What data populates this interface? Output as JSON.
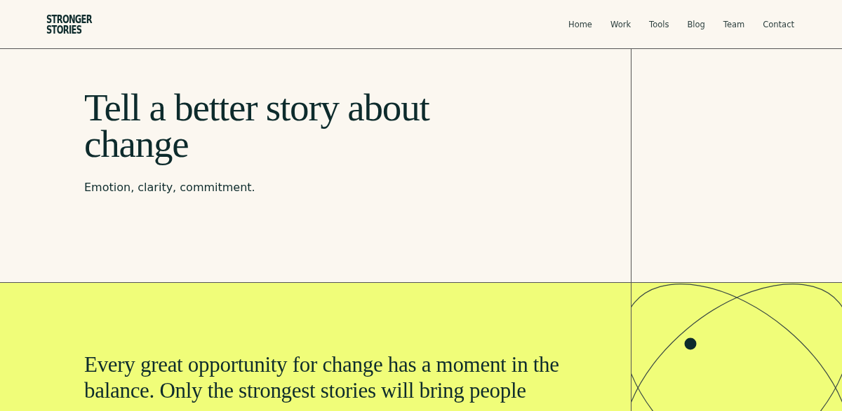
{
  "header": {
    "logo": [
      "STRONGER",
      "STORIES"
    ],
    "nav": [
      {
        "label": "Home"
      },
      {
        "label": "Work"
      },
      {
        "label": "Tools"
      },
      {
        "label": "Blog"
      },
      {
        "label": "Team"
      },
      {
        "label": "Contact"
      }
    ]
  },
  "hero": {
    "title": "Tell a better story about change",
    "subtitle": "Emotion, clarity, commitment."
  },
  "intro": {
    "lines": [
      "Every great opportunity for change has a moment in the",
      "balance. Only the strongest stories will bring people"
    ]
  }
}
